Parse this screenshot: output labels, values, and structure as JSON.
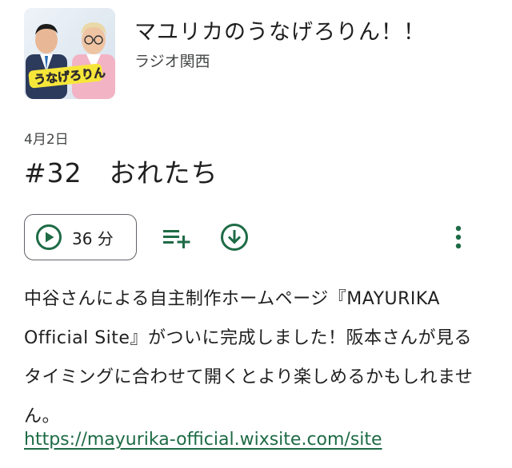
{
  "show": {
    "title": "マユリカのうなげろりん！！",
    "publisher": "ラジオ関西",
    "artwork_logo_text": "うなげろりん"
  },
  "episode": {
    "date": "4月2日",
    "title": "#32　おれたち",
    "duration": "36 分",
    "description": "中谷さんによる自主制作ホームページ『MAYURIKA Official Site』がついに完成しました！阪本さんが見るタイミングに合わせて開くとより楽しめるかもしれません。",
    "link": "https://mayurika-official.wixsite.com/site"
  },
  "icons": {
    "play": "play-circle-icon",
    "queue": "playlist-add-icon",
    "download": "download-circle-icon",
    "more": "more-vert-icon"
  },
  "colors": {
    "accent": "#1e6b46",
    "text": "#1f1f1f",
    "secondary_text": "#444746"
  }
}
